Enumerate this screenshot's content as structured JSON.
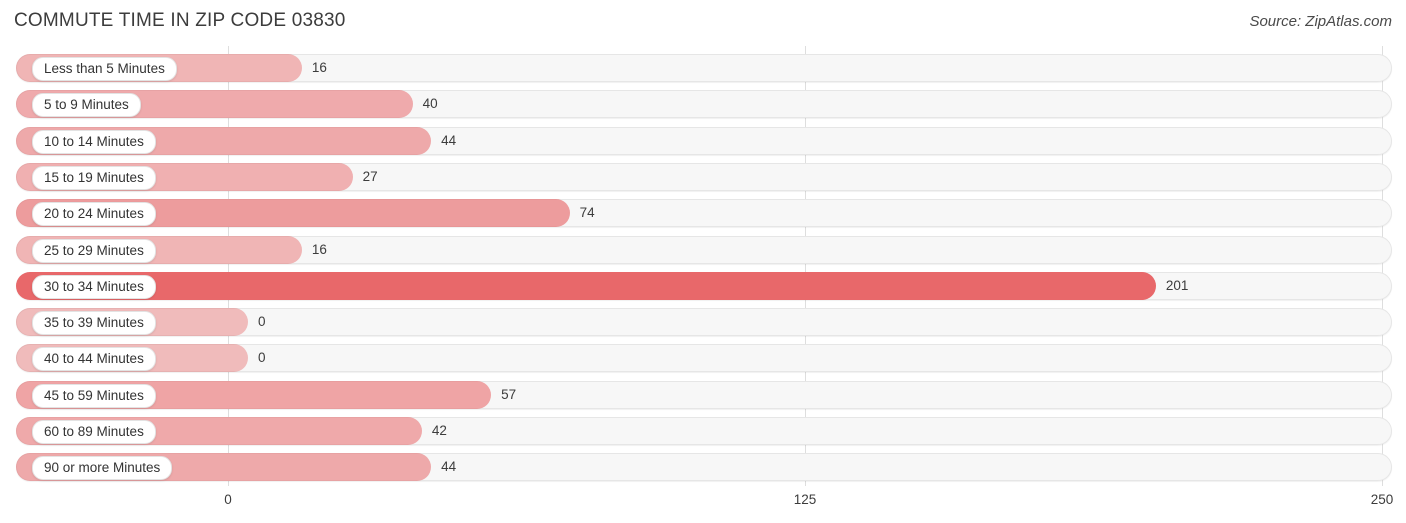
{
  "header": {
    "title": "COMMUTE TIME IN ZIP CODE 03830",
    "source": "Source: ZipAtlas.com"
  },
  "axis": {
    "ticks": [
      "0",
      "125",
      "250"
    ]
  },
  "colors": {
    "bar": "#e8686a",
    "track": "#f7f7f7",
    "gridline": "#dedede",
    "value_text": "#3c3c3c",
    "value_text_inside": "#ffffff"
  },
  "chart_data": {
    "type": "bar",
    "orientation": "horizontal",
    "title": "COMMUTE TIME IN ZIP CODE 03830",
    "subtitle": "",
    "xlabel": "",
    "ylabel": "",
    "xlim": [
      0,
      250
    ],
    "xticks": [
      0,
      125,
      250
    ],
    "grid": true,
    "legend": null,
    "source": "Source: ZipAtlas.com",
    "categories": [
      "Less than 5 Minutes",
      "5 to 9 Minutes",
      "10 to 14 Minutes",
      "15 to 19 Minutes",
      "20 to 24 Minutes",
      "25 to 29 Minutes",
      "30 to 34 Minutes",
      "35 to 39 Minutes",
      "40 to 44 Minutes",
      "45 to 59 Minutes",
      "60 to 89 Minutes",
      "90 or more Minutes"
    ],
    "values": [
      16,
      40,
      44,
      27,
      74,
      16,
      201,
      0,
      0,
      57,
      42,
      44
    ],
    "value_labels": [
      "16",
      "40",
      "44",
      "27",
      "74",
      "16",
      "201",
      "0",
      "0",
      "57",
      "42",
      "44"
    ]
  }
}
